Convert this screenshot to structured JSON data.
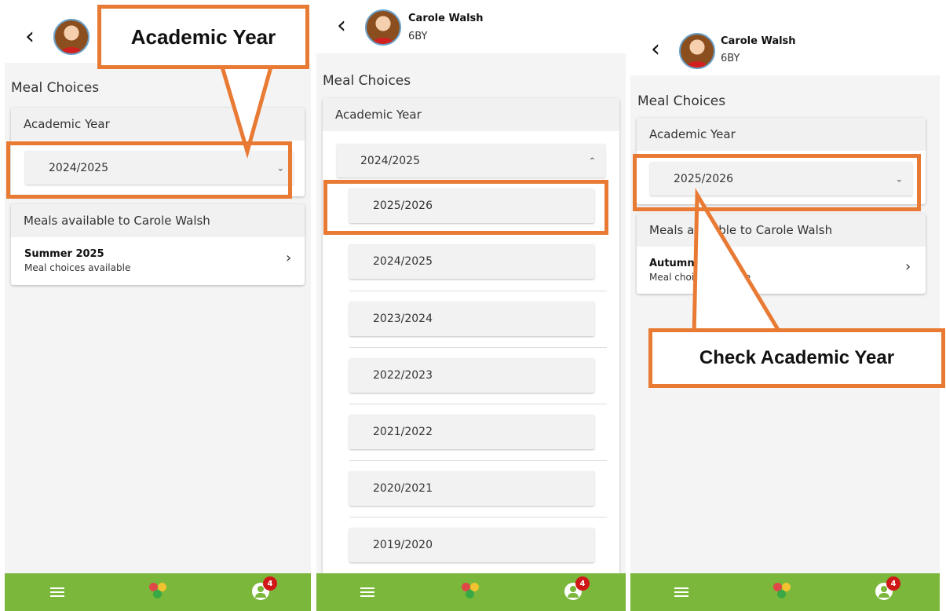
{
  "student": {
    "name": "Carole Walsh",
    "class": "6BY"
  },
  "section_title": "Meal Choices",
  "academic_year_label": "Academic Year",
  "meals_label": "Meals available to Carole Walsh",
  "meals_label_p3": {
    "part1": "Meals av",
    "part2": "ble to Carole Walsh"
  },
  "panel1": {
    "selected_year": "2024/2025",
    "meal": {
      "title": "Summer 2025",
      "subtitle": "Meal choices available"
    }
  },
  "panel2": {
    "selected_year": "2024/2025",
    "options": [
      "2025/2026",
      "2024/2025",
      "2023/2024",
      "2022/2023",
      "2021/2022",
      "2020/2021",
      "2019/2020"
    ]
  },
  "panel3": {
    "selected_year": "2025/2026",
    "meal": {
      "title_visible": "Autumn 2",
      "subtitle_visible_a": "Meal choic",
      "subtitle_visible_b": "e"
    }
  },
  "bottom_nav": {
    "notification_count": "4"
  },
  "callouts": {
    "academic_year": "Academic Year",
    "check_academic_year": "Check Academic Year"
  },
  "icons": {
    "back": "chevron-left-icon",
    "dropdown_closed": "chevron-down-icon",
    "dropdown_open": "chevron-up-icon",
    "meal_arrow": "chevron-right-icon",
    "menu": "hamburger-icon",
    "home": "app-logo-icon",
    "profile": "user-icon"
  },
  "colors": {
    "nav_green": "#7bb73a",
    "annotation_orange": "#e87a33",
    "badge_red": "#d01818"
  }
}
